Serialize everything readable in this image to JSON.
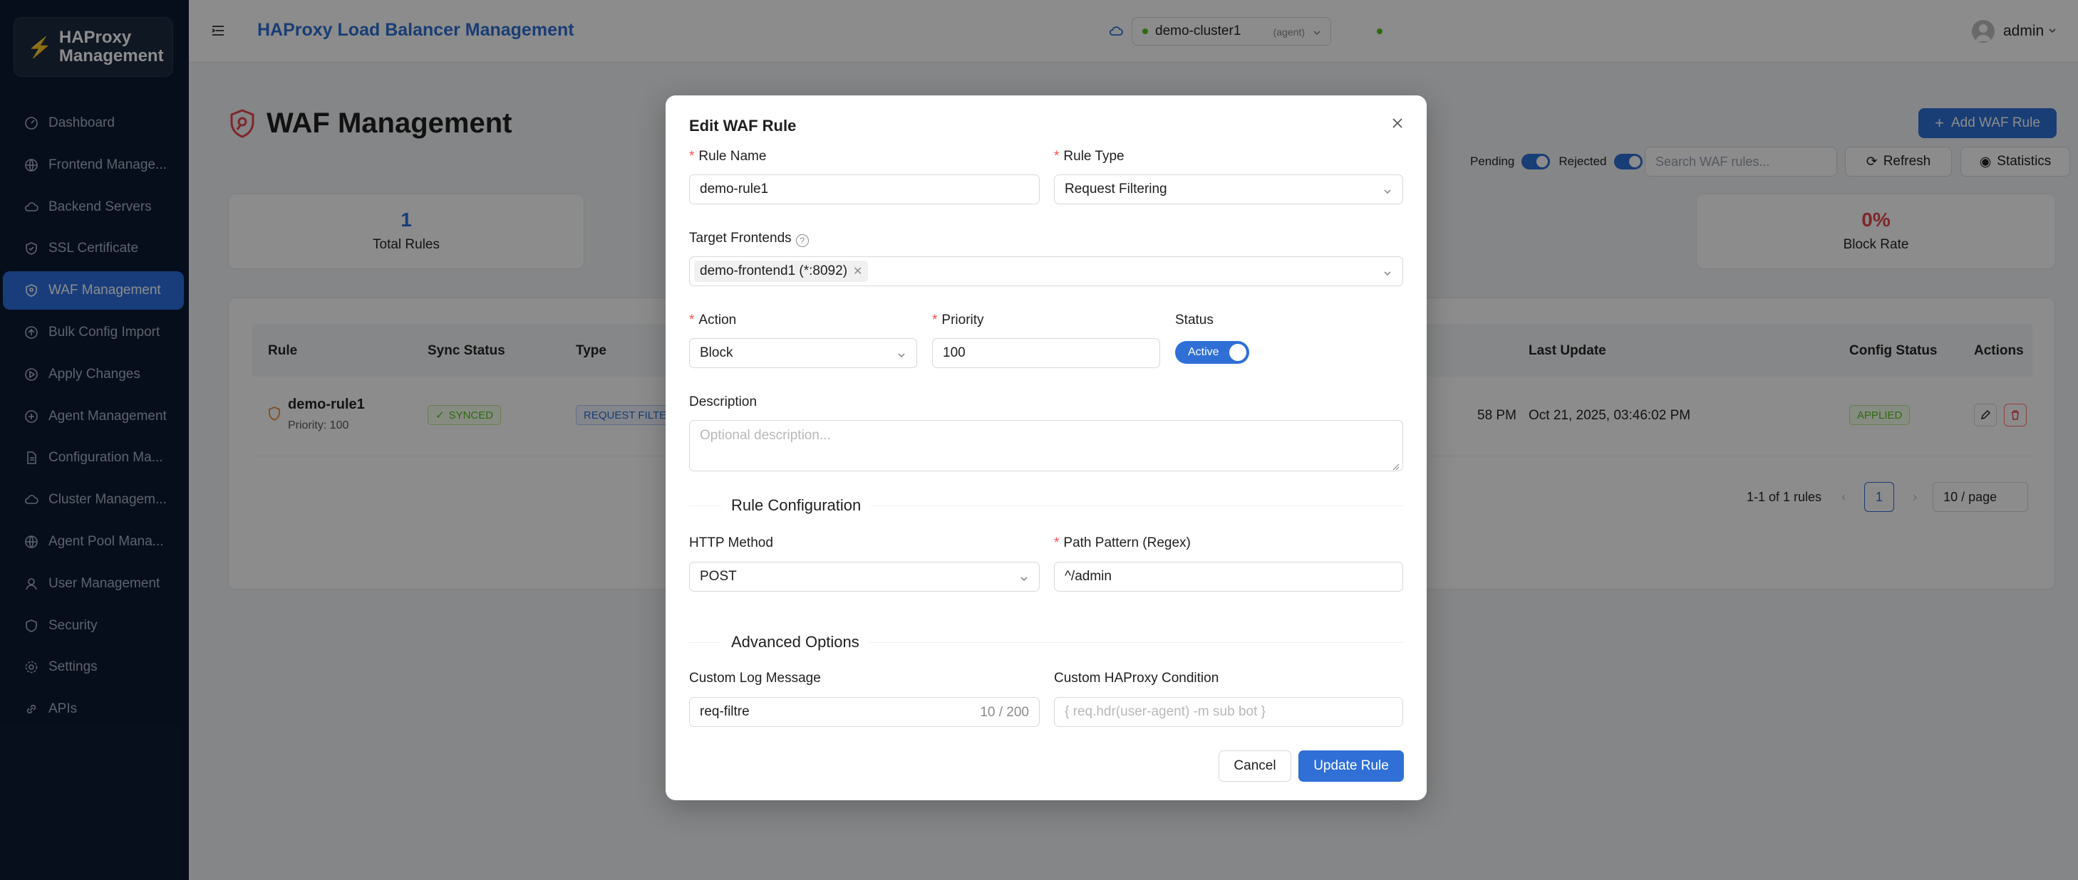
{
  "sidebar": {
    "brand": "HAProxy Management",
    "items": [
      {
        "label": "Dashboard",
        "icon": "dashboard-icon"
      },
      {
        "label": "Frontend Manage...",
        "icon": "globe-icon"
      },
      {
        "label": "Backend Servers",
        "icon": "cloud-icon"
      },
      {
        "label": "SSL Certificate",
        "icon": "shield-check-icon"
      },
      {
        "label": "WAF Management",
        "icon": "shield-icon",
        "active": true
      },
      {
        "label": "Bulk Config Import",
        "icon": "upload-icon"
      },
      {
        "label": "Apply Changes",
        "icon": "play-icon"
      },
      {
        "label": "Agent Management",
        "icon": "robot-icon"
      },
      {
        "label": "Configuration Ma...",
        "icon": "file-icon"
      },
      {
        "label": "Cluster Managem...",
        "icon": "cluster-icon"
      },
      {
        "label": "Agent Pool Mana...",
        "icon": "globe-icon"
      },
      {
        "label": "User Management",
        "icon": "user-icon"
      },
      {
        "label": "Security",
        "icon": "security-icon"
      },
      {
        "label": "Settings",
        "icon": "gear-icon"
      },
      {
        "label": "APIs",
        "icon": "link-icon"
      }
    ]
  },
  "header": {
    "title": "HAProxy Load Balancer Management",
    "cluster": "demo-cluster1",
    "cluster_tag": "(agent)",
    "user": "admin"
  },
  "page": {
    "title": "WAF Management",
    "add_button": "Add WAF Rule",
    "pending_label": "Pending",
    "rejected_label": "Rejected",
    "search_placeholder": "Search WAF rules...",
    "refresh_label": "Refresh",
    "statistics_label": "Statistics",
    "stats": [
      {
        "value": "1",
        "label": "Total Rules",
        "color": "#2f6fd6"
      },
      {
        "value": "0%",
        "label": "Block Rate",
        "color": "#e5484d"
      }
    ],
    "table": {
      "headers": [
        "Rule",
        "Sync Status",
        "Type",
        "Last Update",
        "Config Status",
        "Actions"
      ],
      "row": {
        "rule_name": "demo-rule1",
        "priority": "Priority: 100",
        "sync": "SYNCED",
        "type": "REQUEST FILTE",
        "partial_time": "58 PM",
        "last_update": "Oct 21, 2025, 03:46:02 PM",
        "config_status": "APPLIED"
      }
    },
    "pagination": {
      "summary": "1-1 of 1 rules",
      "current": "1",
      "page_size": "10 / page"
    }
  },
  "modal": {
    "title": "Edit WAF Rule",
    "rule_name_label": "Rule Name",
    "rule_name_value": "demo-rule1",
    "rule_type_label": "Rule Type",
    "rule_type_value": "Request Filtering",
    "target_frontends_label": "Target Frontends",
    "target_frontend_tag": "demo-frontend1 (*:8092)",
    "action_label": "Action",
    "action_value": "Block",
    "priority_label": "Priority",
    "priority_value": "100",
    "status_label": "Status",
    "status_value": "Active",
    "description_label": "Description",
    "description_placeholder": "Optional description...",
    "rule_config_title": "Rule Configuration",
    "http_method_label": "HTTP Method",
    "http_method_value": "POST",
    "path_pattern_label": "Path Pattern (Regex)",
    "path_pattern_value": "^/admin",
    "advanced_title": "Advanced Options",
    "log_message_label": "Custom Log Message",
    "log_message_value": "req-filtre",
    "log_message_counter": "10 / 200",
    "haproxy_condition_label": "Custom HAProxy Condition",
    "haproxy_condition_placeholder": "{ req.hdr(user-agent) -m sub bot }",
    "cancel_label": "Cancel",
    "update_label": "Update Rule"
  }
}
